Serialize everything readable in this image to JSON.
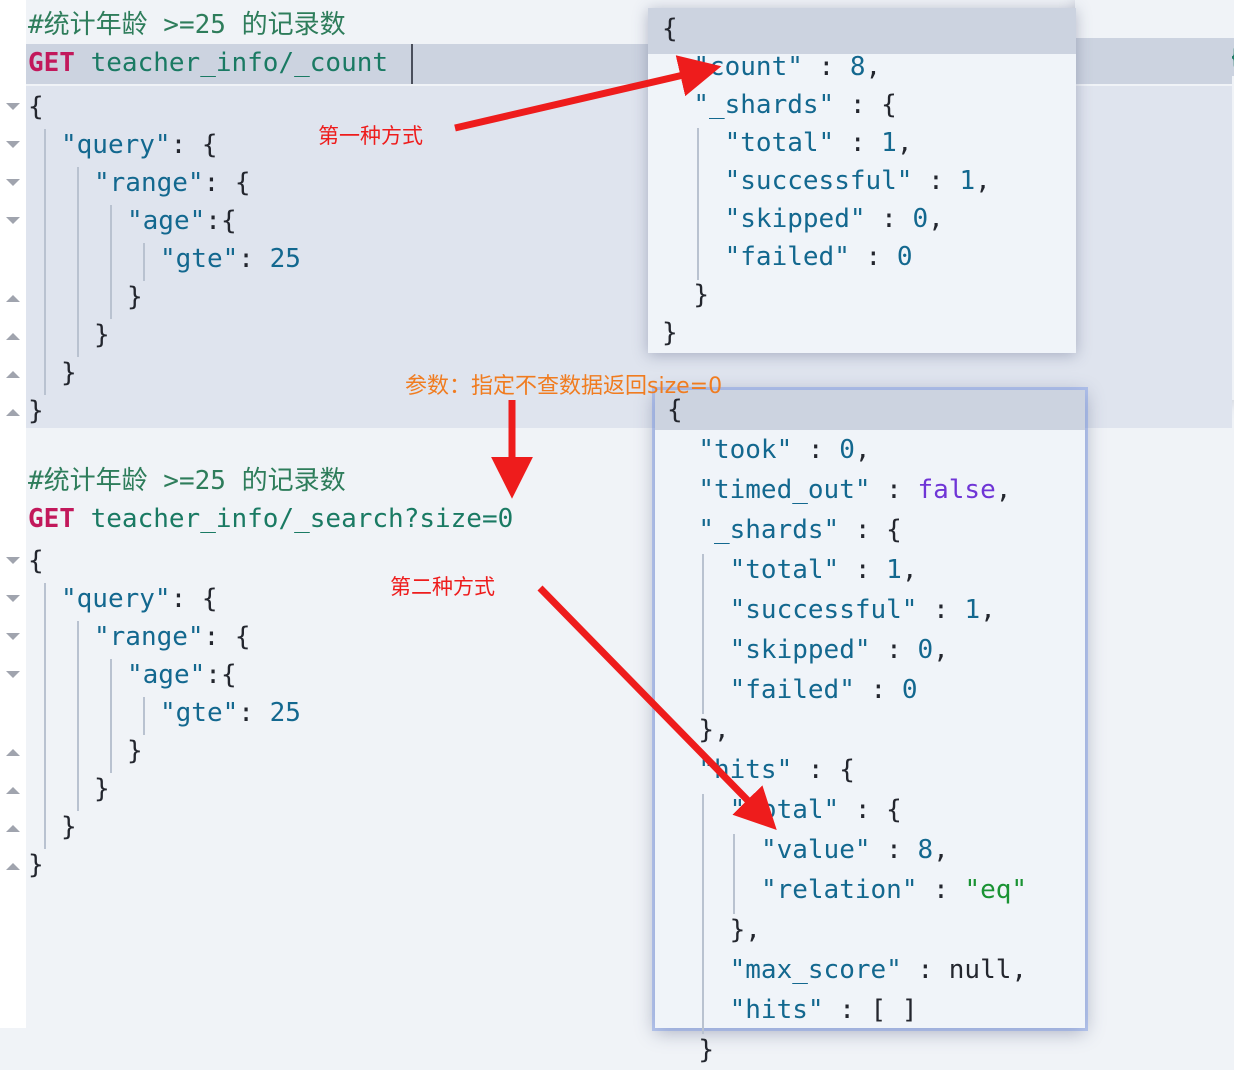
{
  "request_panel": {
    "name": "kibana-dev-tools-request-editor",
    "block1": {
      "comment": "#统计年龄 >=25 的记录数",
      "method": "GET",
      "url": "teacher_info/_count",
      "body_lines": [
        {
          "indent": 0,
          "text": "{",
          "type": "brace",
          "fold": "down"
        },
        {
          "indent": 1,
          "text": "\"query\": {",
          "type": "key",
          "fold": "down"
        },
        {
          "indent": 2,
          "text": "\"range\": {",
          "type": "key",
          "fold": "down"
        },
        {
          "indent": 3,
          "text": "\"age\":{",
          "type": "key",
          "fold": "down"
        },
        {
          "indent": 4,
          "text": "\"gte\": 25",
          "type": "num",
          "fold": ""
        },
        {
          "indent": 3,
          "text": "}",
          "type": "brace",
          "fold": "up"
        },
        {
          "indent": 2,
          "text": "}",
          "type": "brace",
          "fold": "up"
        },
        {
          "indent": 1,
          "text": "}",
          "type": "brace",
          "fold": "up"
        },
        {
          "indent": 0,
          "text": "}",
          "type": "brace",
          "fold": "up"
        }
      ]
    },
    "block2": {
      "comment": "#统计年龄 >=25 的记录数",
      "method": "GET",
      "url": "teacher_info/_search?size=0",
      "body_lines": [
        {
          "indent": 0,
          "text": "{",
          "type": "brace",
          "fold": "down"
        },
        {
          "indent": 1,
          "text": "\"query\": {",
          "type": "key",
          "fold": "down"
        },
        {
          "indent": 2,
          "text": "\"range\": {",
          "type": "key",
          "fold": "down"
        },
        {
          "indent": 3,
          "text": "\"age\":{",
          "type": "key",
          "fold": "down"
        },
        {
          "indent": 4,
          "text": "\"gte\": 25",
          "type": "num",
          "fold": ""
        },
        {
          "indent": 3,
          "text": "}",
          "type": "brace",
          "fold": "up"
        },
        {
          "indent": 2,
          "text": "}",
          "type": "brace",
          "fold": "up"
        },
        {
          "indent": 1,
          "text": "}",
          "type": "brace",
          "fold": "up"
        },
        {
          "indent": 0,
          "text": "}",
          "type": "brace",
          "fold": "up"
        }
      ]
    }
  },
  "response_count": {
    "name": "count-response-panel",
    "lines": [
      "{",
      "  \"count\" : 8,",
      "  \"_shards\" : {",
      "    \"total\" : 1,",
      "    \"successful\" : 1,",
      "    \"skipped\" : 0,",
      "    \"failed\" : 0",
      "  }",
      "}"
    ],
    "values": {
      "count": "8",
      "total": "1",
      "successful": "1",
      "skipped": "0",
      "failed": "0"
    }
  },
  "response_search": {
    "name": "search-response-panel",
    "lines": [
      "{",
      "  \"took\" : 0,",
      "  \"timed_out\" : false,",
      "  \"_shards\" : {",
      "    \"total\" : 1,",
      "    \"successful\" : 1,",
      "    \"skipped\" : 0,",
      "    \"failed\" : 0",
      "  },",
      "  \"hits\" : {",
      "    \"total\" : {",
      "      \"value\" : 8,",
      "      \"relation\" : \"eq\"",
      "    },",
      "    \"max_score\" : null,",
      "    \"hits\" : [ ]",
      "  }"
    ],
    "values": {
      "took": "0",
      "timed_out": "false",
      "total": "1",
      "successful": "1",
      "skipped": "0",
      "failed": "0",
      "hits_total_value": "8",
      "hits_total_relation": "\"eq\"",
      "max_score": "null",
      "hits": "[ ]"
    }
  },
  "annotations": {
    "first_method": "第一种方式",
    "second_method": "第二种方式",
    "param_note": "参数：指定不查数据返回size=0"
  },
  "colors": {
    "annotation_red": "#ee1c1c",
    "annotation_orange": "#f07c20",
    "method": "#c2185b",
    "url": "#1a7a63",
    "comment": "#2e7d5b",
    "json_key": "#13688f",
    "json_string": "#1a9334",
    "json_boolean": "#6f35d6",
    "editor_bg": "#f0f3f7",
    "selection_bg": "#dfe4ee",
    "current_line_bg": "#ccd3e0"
  }
}
